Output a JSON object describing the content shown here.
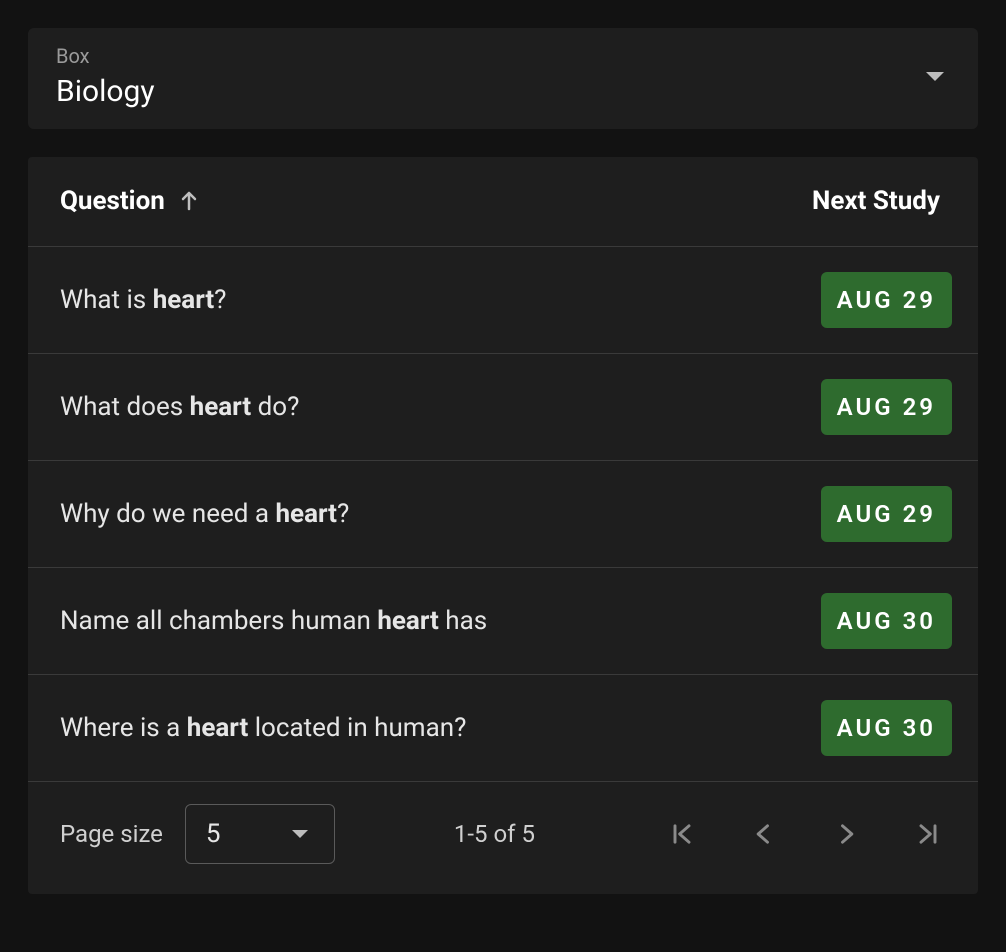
{
  "boxSelect": {
    "label": "Box",
    "value": "Biology"
  },
  "table": {
    "headers": {
      "question": "Question",
      "nextStudy": "Next Study"
    },
    "highlightTerm": "heart",
    "rows": [
      {
        "question": "What is heart?",
        "nextStudy": "AUG 29"
      },
      {
        "question": "What does heart do?",
        "nextStudy": "AUG 29"
      },
      {
        "question": "Why do we need a heart?",
        "nextStudy": "AUG 29"
      },
      {
        "question": "Name all chambers human heart has",
        "nextStudy": "AUG 30"
      },
      {
        "question": "Where is a heart located in human?",
        "nextStudy": "AUG 30"
      }
    ]
  },
  "pagination": {
    "pageSizeLabel": "Page size",
    "pageSize": "5",
    "rangeLabel": "1-5 of 5"
  }
}
